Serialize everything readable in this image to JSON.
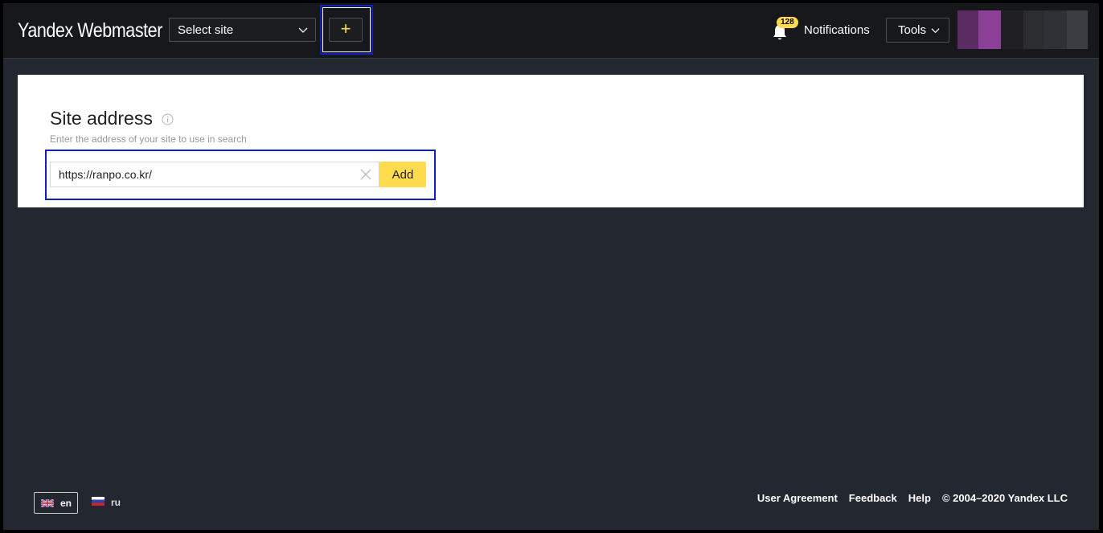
{
  "header": {
    "logo": "Yandex Webmaster",
    "site_select": {
      "label": "Select site",
      "icon": "chevron-down-icon"
    },
    "add_site_button": {
      "label": "+"
    },
    "notifications": {
      "count": "128",
      "label": "Notifications",
      "icon": "bell-icon"
    },
    "tools": {
      "label": "Tools",
      "icon": "chevron-down-icon"
    }
  },
  "main": {
    "title": "Site address",
    "title_icon": "info-icon",
    "hint": "Enter the address of your site to use in search",
    "url_input": {
      "value": "https://ranpo.co.kr/"
    },
    "add_button": "Add"
  },
  "footer": {
    "languages": [
      {
        "code": "en",
        "flag": "uk-flag-icon",
        "active": true
      },
      {
        "code": "ru",
        "flag": "ru-flag-icon",
        "active": false
      }
    ],
    "links": [
      "User Agreement",
      "Feedback",
      "Help"
    ],
    "copyright": "© 2004–2020 Yandex LLC"
  },
  "colors": {
    "accent_yellow": "#ffdb4d",
    "page_bg": "#23272f",
    "header_bg": "#16181c",
    "highlight_blue": "#1020b8"
  }
}
